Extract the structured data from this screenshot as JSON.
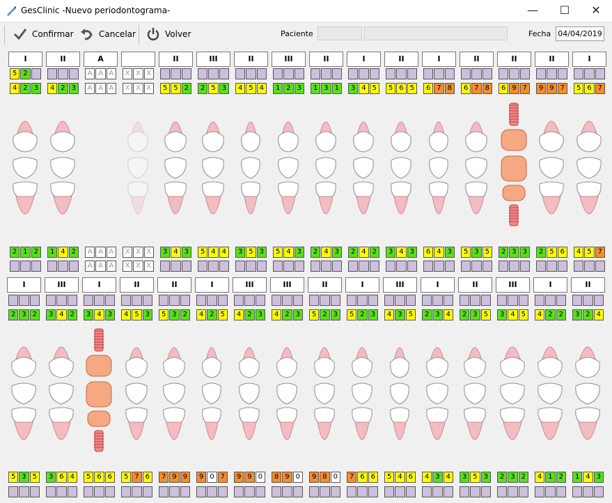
{
  "window": {
    "title": "GesClinic -Nuevo periodontograma-",
    "minimize": "—",
    "maximize": "☐",
    "close": "✕"
  },
  "toolbar": {
    "confirm": "Confirmar",
    "cancel": "Cancelar",
    "back": "Volver",
    "patient_label": "Paciente",
    "patient_value": "",
    "patient_name": "",
    "date_label": "Fecha",
    "date_value": "04/04/2019"
  },
  "colors": {
    "yellow": "#fefe00",
    "green": "#59e01a",
    "orange": "#f58d2a",
    "white": "#ffffff",
    "lilac": "#cdc0dc",
    "implant": "#f5a882"
  },
  "upper": [
    {
      "mob": "I",
      "top": [
        "5",
        "2",
        ""
      ],
      "bot": [
        "4",
        "2",
        "3"
      ],
      "pal": [
        "2",
        "1",
        "2"
      ],
      "pal2": [
        "",
        "",
        ""
      ],
      "kind": "molar"
    },
    {
      "mob": "II",
      "top": [
        "",
        "",
        ""
      ],
      "bot": [
        "4",
        "2",
        "3"
      ],
      "pal": [
        "1",
        "4",
        "2"
      ],
      "pal2": [
        "",
        "",
        ""
      ],
      "kind": "molar"
    },
    {
      "mob": "A",
      "top": [
        "A",
        "A",
        "A"
      ],
      "bot": [
        "A",
        "A",
        "A"
      ],
      "pal": [
        "A",
        "A",
        "A"
      ],
      "pal2": [
        "A",
        "A",
        "A"
      ],
      "kind": "absent"
    },
    {
      "mob": "",
      "top": [
        "X",
        "X",
        "X"
      ],
      "bot": [
        "X",
        "X",
        "X"
      ],
      "pal": [
        "X",
        "X",
        "X"
      ],
      "pal2": [
        "X",
        "X",
        "X"
      ],
      "kind": "ghost"
    },
    {
      "mob": "II",
      "top": [
        "",
        "",
        ""
      ],
      "bot": [
        "5",
        "5",
        "2"
      ],
      "pal": [
        "3",
        "4",
        "3"
      ],
      "pal2": [
        "",
        "",
        ""
      ],
      "kind": "premolar"
    },
    {
      "mob": "III",
      "top": [
        "",
        "",
        ""
      ],
      "bot": [
        "2",
        "5",
        "3"
      ],
      "pal": [
        "5",
        "4",
        "4"
      ],
      "pal2": [
        "",
        "",
        ""
      ],
      "kind": "premolar"
    },
    {
      "mob": "II",
      "top": [
        "",
        "",
        ""
      ],
      "bot": [
        "4",
        "5",
        "4"
      ],
      "pal": [
        "3",
        "5",
        "3"
      ],
      "pal2": [
        "",
        "",
        ""
      ],
      "kind": "canine"
    },
    {
      "mob": "III",
      "top": [
        "",
        "",
        ""
      ],
      "bot": [
        "1",
        "2",
        "3"
      ],
      "pal": [
        "5",
        "4",
        "3"
      ],
      "pal2": [
        "",
        "",
        ""
      ],
      "kind": "incisor"
    },
    {
      "mob": "II",
      "top": [
        "",
        "",
        ""
      ],
      "bot": [
        "1",
        "3",
        "1"
      ],
      "pal": [
        "2",
        "4",
        "3"
      ],
      "pal2": [
        "",
        "",
        ""
      ],
      "kind": "incisor"
    },
    {
      "mob": "I",
      "top": [
        "",
        "",
        ""
      ],
      "bot": [
        "3",
        "4",
        "5"
      ],
      "pal": [
        "2",
        "4",
        "2"
      ],
      "pal2": [
        "",
        "",
        ""
      ],
      "kind": "incisor"
    },
    {
      "mob": "II",
      "top": [
        "",
        "",
        ""
      ],
      "bot": [
        "5",
        "6",
        "5"
      ],
      "pal": [
        "3",
        "4",
        "3"
      ],
      "pal2": [
        "",
        "",
        ""
      ],
      "kind": "incisor"
    },
    {
      "mob": "I",
      "top": [
        "",
        "",
        ""
      ],
      "bot": [
        "6",
        "7",
        "8"
      ],
      "pal": [
        "6",
        "4",
        "3"
      ],
      "pal2": [
        "",
        "",
        ""
      ],
      "kind": "canine"
    },
    {
      "mob": "II",
      "top": [
        "",
        "",
        ""
      ],
      "bot": [
        "6",
        "7",
        "8"
      ],
      "pal": [
        "5",
        "3",
        "5"
      ],
      "pal2": [
        "",
        "",
        ""
      ],
      "kind": "premolar"
    },
    {
      "mob": "II",
      "top": [
        "",
        "",
        ""
      ],
      "bot": [
        "6",
        "9",
        "7"
      ],
      "pal": [
        "2",
        "3",
        "3"
      ],
      "pal2": [
        "",
        "",
        ""
      ],
      "kind": "implant"
    },
    {
      "mob": "II",
      "top": [
        "",
        "",
        ""
      ],
      "bot": [
        "9",
        "9",
        "7"
      ],
      "pal": [
        "2",
        "5",
        "6"
      ],
      "pal2": [
        "",
        "",
        ""
      ],
      "kind": "molar"
    },
    {
      "mob": "I",
      "top": [
        "",
        "",
        ""
      ],
      "bot": [
        "5",
        "6",
        "7"
      ],
      "pal": [
        "4",
        "5",
        "7"
      ],
      "pal2": [
        "",
        "",
        ""
      ],
      "kind": "molar"
    }
  ],
  "lower": [
    {
      "mob": "I",
      "top": [
        "",
        "",
        ""
      ],
      "bot": [
        "2",
        "3",
        "2"
      ],
      "ling": [
        "5",
        "3",
        "5"
      ],
      "ling2": [
        "",
        "",
        ""
      ],
      "kind": "molar"
    },
    {
      "mob": "III",
      "top": [
        "",
        "",
        ""
      ],
      "bot": [
        "3",
        "4",
        "2"
      ],
      "ling": [
        "3",
        "6",
        "4"
      ],
      "ling2": [
        "",
        "",
        ""
      ],
      "kind": "molar"
    },
    {
      "mob": "I",
      "top": [
        "",
        "",
        ""
      ],
      "bot": [
        "3",
        "4",
        "3"
      ],
      "ling": [
        "5",
        "6",
        "6"
      ],
      "ling2": [
        "",
        "",
        ""
      ],
      "kind": "implant"
    },
    {
      "mob": "II",
      "top": [
        "",
        "",
        ""
      ],
      "bot": [
        "4",
        "5",
        "3"
      ],
      "ling": [
        "5",
        "7",
        "6"
      ],
      "ling2": [
        "",
        "",
        ""
      ],
      "kind": "premolar"
    },
    {
      "mob": "II",
      "top": [
        "",
        "",
        ""
      ],
      "bot": [
        "5",
        "3",
        "2"
      ],
      "ling": [
        "7",
        "9",
        "9"
      ],
      "ling2": [
        "",
        "",
        ""
      ],
      "kind": "premolar"
    },
    {
      "mob": "I",
      "top": [
        "",
        "",
        ""
      ],
      "bot": [
        "4",
        "2",
        "5"
      ],
      "ling": [
        "9",
        "0",
        "7"
      ],
      "ling2": [
        "",
        "",
        ""
      ],
      "kind": "canine"
    },
    {
      "mob": "III",
      "top": [
        "",
        "",
        ""
      ],
      "bot": [
        "4",
        "2",
        "3"
      ],
      "ling": [
        "9",
        "9",
        "0"
      ],
      "ling2": [
        "",
        "",
        ""
      ],
      "kind": "incisor"
    },
    {
      "mob": "III",
      "top": [
        "",
        "",
        ""
      ],
      "bot": [
        "4",
        "2",
        "3"
      ],
      "ling": [
        "8",
        "9",
        "0"
      ],
      "ling2": [
        "",
        "",
        ""
      ],
      "kind": "incisor"
    },
    {
      "mob": "II",
      "top": [
        "",
        "",
        ""
      ],
      "bot": [
        "5",
        "2",
        "3"
      ],
      "ling": [
        "9",
        "8",
        "0"
      ],
      "ling2": [
        "",
        "",
        ""
      ],
      "kind": "incisor"
    },
    {
      "mob": "I",
      "top": [
        "",
        "",
        ""
      ],
      "bot": [
        "5",
        "2",
        "3"
      ],
      "ling": [
        "7",
        "6",
        "6"
      ],
      "ling2": [
        "",
        "",
        ""
      ],
      "kind": "incisor"
    },
    {
      "mob": "III",
      "top": [
        "",
        "",
        ""
      ],
      "bot": [
        "4",
        "3",
        "5"
      ],
      "ling": [
        "5",
        "4",
        "6"
      ],
      "ling2": [
        "",
        "",
        ""
      ],
      "kind": "canine"
    },
    {
      "mob": "I",
      "top": [
        "",
        "",
        ""
      ],
      "bot": [
        "2",
        "3",
        "4"
      ],
      "ling": [
        "4",
        "3",
        "4"
      ],
      "ling2": [
        "",
        "",
        ""
      ],
      "kind": "premolar"
    },
    {
      "mob": "II",
      "top": [
        "",
        "",
        ""
      ],
      "bot": [
        "2",
        "3",
        "5"
      ],
      "ling": [
        "3",
        "5",
        "3"
      ],
      "ling2": [
        "",
        "",
        ""
      ],
      "kind": "premolar"
    },
    {
      "mob": "III",
      "top": [
        "",
        "",
        ""
      ],
      "bot": [
        "3",
        "4",
        "5"
      ],
      "ling": [
        "2",
        "3",
        "2"
      ],
      "ling2": [
        "",
        "",
        ""
      ],
      "kind": "molar"
    },
    {
      "mob": "I",
      "top": [
        "",
        "",
        ""
      ],
      "bot": [
        "4",
        "2",
        "2"
      ],
      "ling": [
        "4",
        "1",
        "2"
      ],
      "ling2": [
        "",
        "",
        ""
      ],
      "kind": "molar"
    },
    {
      "mob": "II",
      "top": [
        "",
        "",
        ""
      ],
      "bot": [
        "3",
        "2",
        "4"
      ],
      "ling": [
        "1",
        "4",
        "3"
      ],
      "ling2": [
        "",
        "",
        ""
      ],
      "kind": "molar"
    }
  ]
}
